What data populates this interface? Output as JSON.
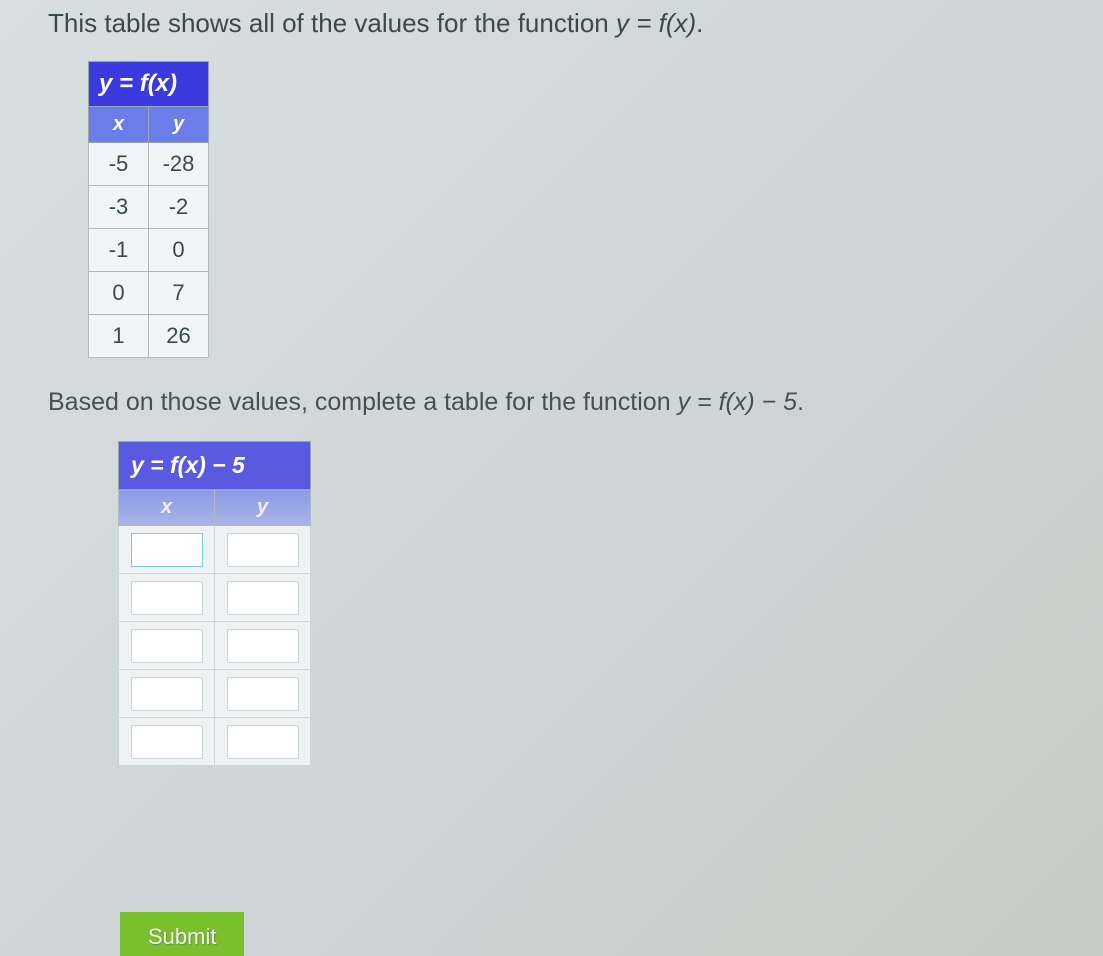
{
  "prompt1_pre": "This table shows all of the values for the function ",
  "prompt1_eq": "y = f(x)",
  "prompt1_post": ".",
  "table1": {
    "title": "y = f(x)",
    "col_x": "x",
    "col_y": "y",
    "rows": [
      {
        "x": "-5",
        "y": "-28"
      },
      {
        "x": "-3",
        "y": "-2"
      },
      {
        "x": "-1",
        "y": "0"
      },
      {
        "x": "0",
        "y": "7"
      },
      {
        "x": "1",
        "y": "26"
      }
    ]
  },
  "prompt2_pre": "Based on those values, complete a table for the function ",
  "prompt2_eq": "y = f(x) − 5",
  "prompt2_post": ".",
  "table2": {
    "title": "y = f(x) − 5",
    "col_x": "x",
    "col_y": "y",
    "rows": [
      {
        "x": "",
        "y": ""
      },
      {
        "x": "",
        "y": ""
      },
      {
        "x": "",
        "y": ""
      },
      {
        "x": "",
        "y": ""
      },
      {
        "x": "",
        "y": ""
      }
    ]
  },
  "submit_label": "Submit"
}
